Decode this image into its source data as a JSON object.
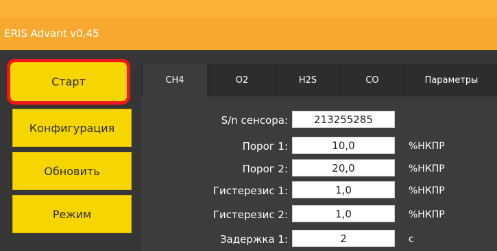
{
  "window": {
    "title": "ERIS Advant v0.45"
  },
  "sidebar": {
    "buttons": [
      {
        "label": "Старт"
      },
      {
        "label": "Конфигурация"
      },
      {
        "label": "Обновить"
      },
      {
        "label": "Режим"
      }
    ]
  },
  "tabs": [
    {
      "label": "CH4"
    },
    {
      "label": "O2"
    },
    {
      "label": "H2S"
    },
    {
      "label": "CO"
    },
    {
      "label": "Параметры"
    }
  ],
  "form": {
    "fields": [
      {
        "label": "S/n сенсора:",
        "value": "213255285",
        "unit": ""
      },
      {
        "label": "Порог 1:",
        "value": "10,0",
        "unit": "%НКПР"
      },
      {
        "label": "Порог 2:",
        "value": "20,0",
        "unit": "%НКПР"
      },
      {
        "label": "Гистерезис 1:",
        "value": "1,0",
        "unit": "%НКПР"
      },
      {
        "label": "Гистерезис 2:",
        "value": "1,0",
        "unit": "%НКПР"
      },
      {
        "label": "Задержка 1:",
        "value": "2",
        "unit": "с"
      }
    ]
  }
}
